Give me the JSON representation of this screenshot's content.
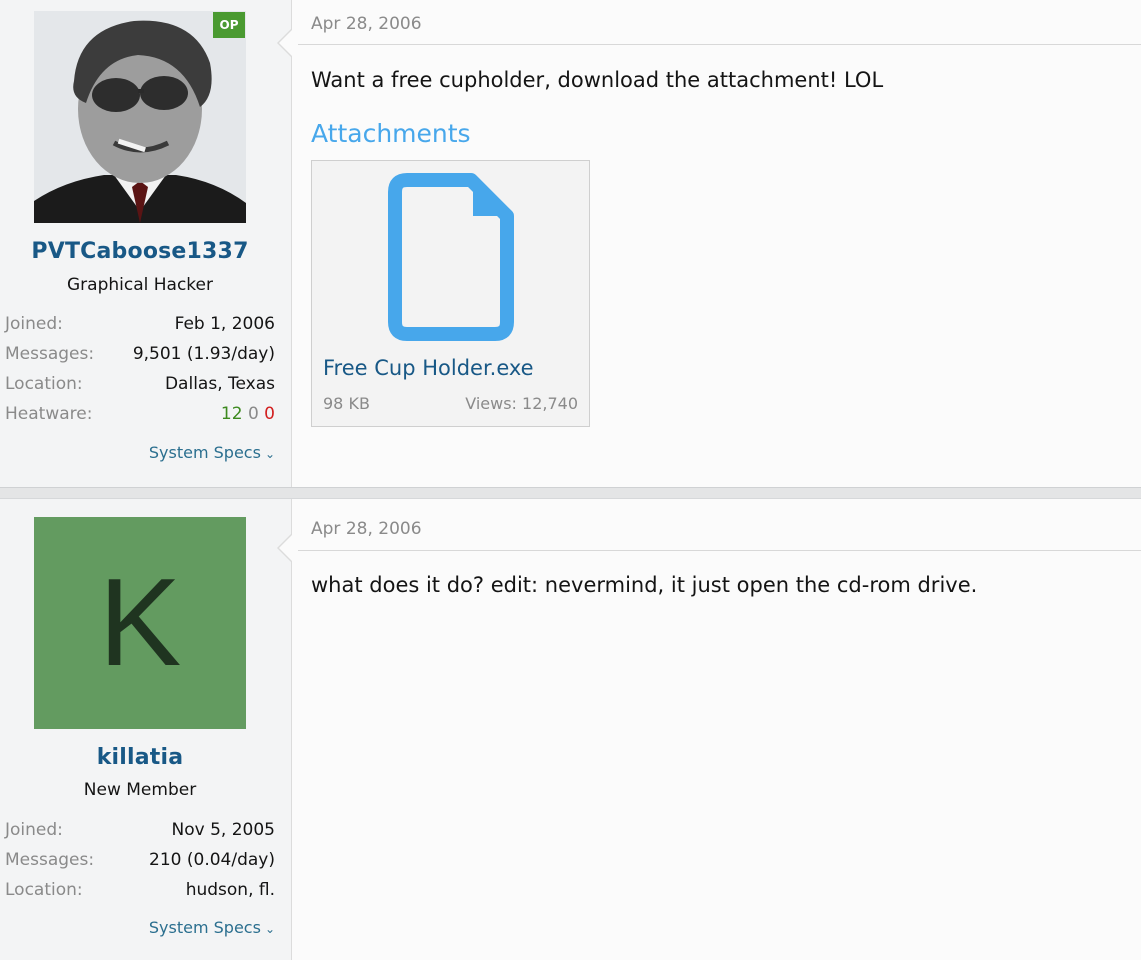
{
  "posts": [
    {
      "user": {
        "avatar_desc": "photo-avatar",
        "op_badge": "OP",
        "username": "PVTCaboose1337",
        "title": "Graphical Hacker",
        "info": [
          {
            "label": "Joined:",
            "value": "Feb 1, 2006"
          },
          {
            "label": "Messages:",
            "value": "9,501 (1.93/day)"
          },
          {
            "label": "Location:",
            "value": "Dallas, Texas"
          }
        ],
        "heatware": {
          "label": "Heatware:",
          "positive": "12",
          "neutral": "0",
          "negative": "0"
        },
        "system_specs": "System Specs"
      },
      "date": "Apr 28, 2006",
      "message": "Want a free cupholder, download the attachment! LOL",
      "attachments_heading": "Attachments",
      "attachment": {
        "name": "Free Cup Holder.exe",
        "size": "98 KB",
        "views": "Views: 12,740"
      }
    },
    {
      "user": {
        "avatar_letter": "K",
        "avatar_color": "#639b60",
        "username": "killatia",
        "title": "New Member",
        "info": [
          {
            "label": "Joined:",
            "value": "Nov 5, 2005"
          },
          {
            "label": "Messages:",
            "value": "210 (0.04/day)"
          },
          {
            "label": "Location:",
            "value": "hudson, fl."
          }
        ],
        "system_specs": "System Specs"
      },
      "date": "Apr 28, 2006",
      "message": "what does it do? edit: nevermind, it just open the cd-rom drive."
    }
  ],
  "colors": {
    "username": "#185886",
    "attachments_heading": "#47a7eb",
    "op_badge": "#4a9a31",
    "heat_positive": "#3d8a1f",
    "heat_negative": "#d21f1f"
  },
  "icons": {
    "file": "file-icon",
    "chevron": "chevron-down-icon"
  }
}
